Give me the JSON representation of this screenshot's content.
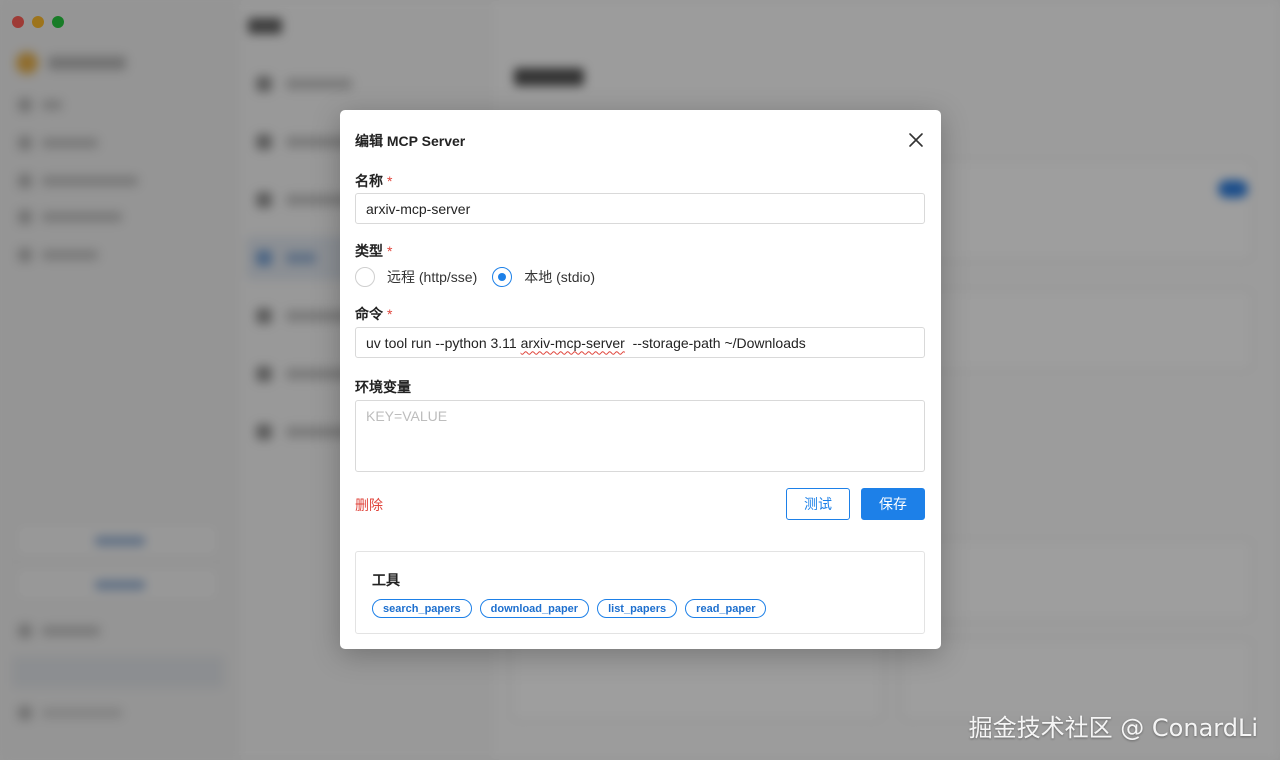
{
  "dialog": {
    "title": "编辑 MCP Server",
    "name_label": "名称",
    "name_value": "arxiv-mcp-server",
    "type_label": "类型",
    "type_options": [
      {
        "label": "远程 (http/sse)",
        "checked": false
      },
      {
        "label": "本地 (stdio)",
        "checked": true
      }
    ],
    "command_label": "命令",
    "command_prefix": "uv tool run --python 3.11 ",
    "command_flagged": "arxiv-mcp-server",
    "command_suffix": "  --storage-path ~/Downloads",
    "env_label": "环境变量",
    "env_placeholder": "KEY=VALUE",
    "required_mark": "*",
    "delete_label": "删除",
    "test_label": "测试",
    "save_label": "保存",
    "tools_title": "工具",
    "tools": [
      "search_papers",
      "download_paper",
      "list_papers",
      "read_paper"
    ]
  },
  "watermark": "掘金技术社区 @ ConardLi",
  "colors": {
    "accent": "#1d80e8",
    "danger": "#e0443b",
    "traffic_red": "#ff5f57",
    "traffic_yellow": "#febc2e",
    "traffic_green": "#28c840"
  },
  "icons": {
    "close": "close-icon"
  }
}
